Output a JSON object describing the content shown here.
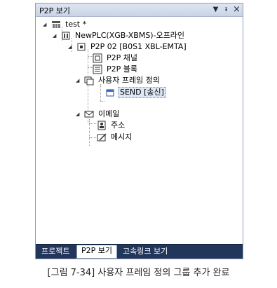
{
  "panel": {
    "title": "P2P 보기",
    "controls": {
      "dropdown": "▼",
      "pin": "ᵻ",
      "close": "×"
    }
  },
  "tree": {
    "nodes": [
      {
        "label": "test *",
        "icon": "project-icon",
        "expanded": true
      },
      {
        "label": "NewPLC(XGB-XBMS)-오프라인",
        "icon": "plc-icon",
        "expanded": true
      },
      {
        "label": "P2P 02 [B0S1 XBL-EMTA]",
        "icon": "p2p-module-icon",
        "expanded": true
      },
      {
        "label": "P2P 채널",
        "icon": "channel-icon"
      },
      {
        "label": "P2P 블록",
        "icon": "block-icon"
      },
      {
        "label": "사용자 프레임 정의",
        "icon": "frame-icon",
        "expanded": true
      },
      {
        "label": "SEND [송신]",
        "icon": "send-frame-icon",
        "selected": true
      },
      {
        "label": "이메일",
        "icon": "email-icon",
        "expanded": true
      },
      {
        "label": "주소",
        "icon": "address-book-icon"
      },
      {
        "label": "메시지",
        "icon": "message-icon"
      }
    ]
  },
  "tabs": [
    {
      "label": "프로젝트",
      "active": false
    },
    {
      "label": "P2P 보기",
      "active": true
    },
    {
      "label": "고속링크 보기",
      "active": false
    }
  ],
  "caption": "[그림 7-34] 사용자 프레임 정의 그룹 추가 완료"
}
